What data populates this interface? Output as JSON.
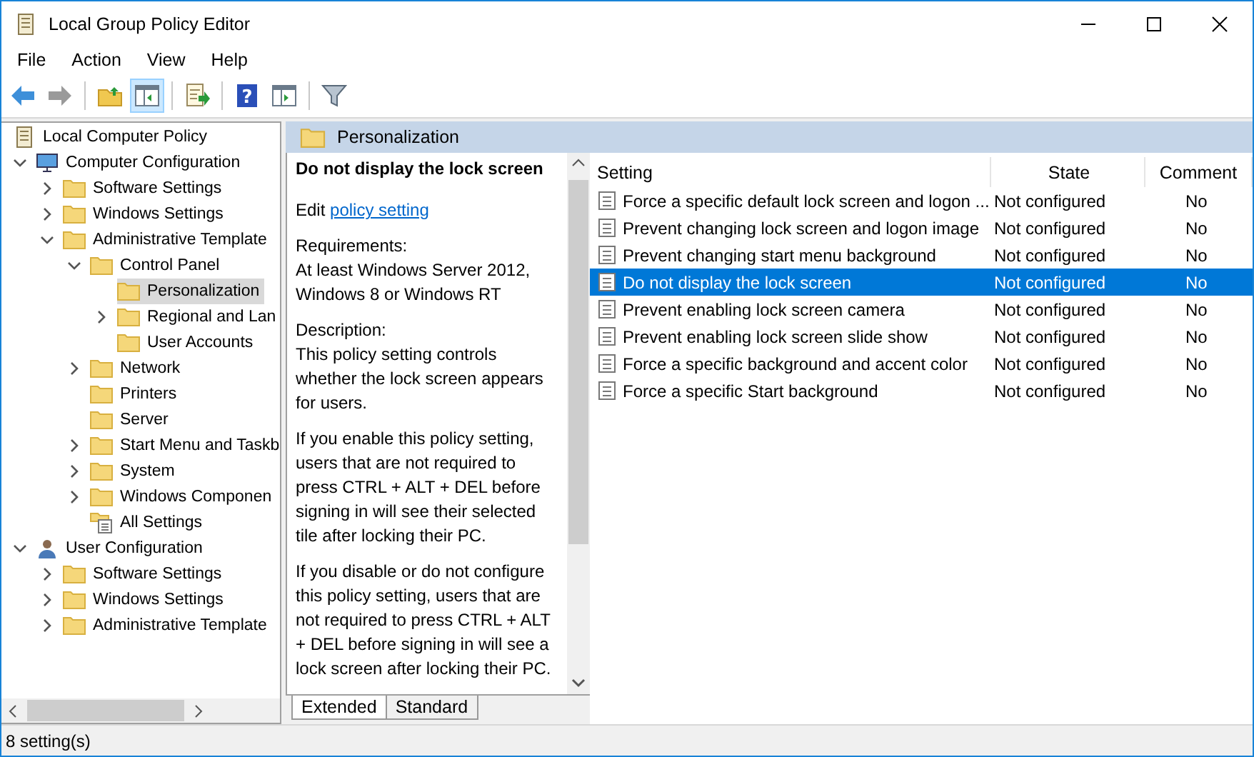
{
  "window": {
    "title": "Local Group Policy Editor"
  },
  "menu": [
    "File",
    "Action",
    "View",
    "Help"
  ],
  "toolbar": [
    {
      "kind": "back",
      "disabled": false,
      "pressed": false
    },
    {
      "kind": "forward",
      "disabled": true,
      "pressed": false
    },
    {
      "kind": "separator"
    },
    {
      "kind": "up",
      "pressed": false
    },
    {
      "kind": "tree-toggle",
      "pressed": true
    },
    {
      "kind": "separator"
    },
    {
      "kind": "export",
      "pressed": false
    },
    {
      "kind": "separator"
    },
    {
      "kind": "help",
      "glyph": "?",
      "pressed": false
    },
    {
      "kind": "pane-toggle",
      "pressed": false
    },
    {
      "kind": "separator"
    },
    {
      "kind": "filter",
      "pressed": false
    }
  ],
  "tree": {
    "label": "Local Computer Policy",
    "kind": "policy",
    "selected": false,
    "children": [
      {
        "label": "Computer Configuration",
        "kind": "computer",
        "expanded": true,
        "selected": false,
        "children": [
          {
            "label": "Software Settings",
            "kind": "folder",
            "expanded": false,
            "selected": false
          },
          {
            "label": "Windows Settings",
            "kind": "folder",
            "expanded": false,
            "selected": false
          },
          {
            "label": "Administrative Template",
            "kind": "folder",
            "expanded": true,
            "selected": false,
            "children": [
              {
                "label": "Control Panel",
                "kind": "folder",
                "expanded": true,
                "selected": false,
                "children": [
                  {
                    "label": "Personalization",
                    "kind": "folder",
                    "selected": true
                  },
                  {
                    "label": "Regional and Lan",
                    "kind": "folder",
                    "expanded": false,
                    "selected": false
                  },
                  {
                    "label": "User Accounts",
                    "kind": "folder",
                    "selected": false
                  }
                ]
              },
              {
                "label": "Network",
                "kind": "folder",
                "expanded": false,
                "selected": false
              },
              {
                "label": "Printers",
                "kind": "folder",
                "selected": false
              },
              {
                "label": "Server",
                "kind": "folder",
                "selected": false
              },
              {
                "label": "Start Menu and Taskb",
                "kind": "folder",
                "expanded": false,
                "selected": false
              },
              {
                "label": "System",
                "kind": "folder",
                "expanded": false,
                "selected": false
              },
              {
                "label": "Windows Componen",
                "kind": "folder",
                "expanded": false,
                "selected": false
              },
              {
                "label": "All Settings",
                "kind": "settings",
                "selected": false
              }
            ]
          }
        ]
      },
      {
        "label": "User Configuration",
        "kind": "user",
        "expanded": true,
        "selected": false,
        "children": [
          {
            "label": "Software Settings",
            "kind": "folder",
            "expanded": false,
            "selected": false
          },
          {
            "label": "Windows Settings",
            "kind": "folder",
            "expanded": false,
            "selected": false
          },
          {
            "label": "Administrative Template",
            "kind": "folder",
            "expanded": false,
            "selected": false
          }
        ]
      }
    ]
  },
  "header": {
    "title": "Personalization"
  },
  "description": {
    "title": "Do not display the lock screen",
    "edit_prefix": "Edit",
    "edit_link": "policy setting",
    "paragraphs": [
      "Requirements:\nAt least Windows Server 2012, Windows 8 or Windows RT",
      "Description:\nThis policy setting controls whether the lock screen appears for users.",
      "If you enable this policy setting, users that are not required to press CTRL + ALT + DEL before signing in will see their selected tile after locking their PC.",
      "If you disable or do not configure this policy setting, users that are not required to press CTRL + ALT + DEL before signing in will see a lock screen after locking their PC."
    ]
  },
  "view_tabs": [
    {
      "label": "Extended",
      "selected": true
    },
    {
      "label": "Standard",
      "selected": false
    }
  ],
  "table": {
    "columns": [
      "Setting",
      "State",
      "Comment"
    ],
    "rows": [
      {
        "setting": "Force a specific default lock screen and logon ...",
        "state": "Not configured",
        "comment": "No",
        "selected": false
      },
      {
        "setting": "Prevent changing lock screen and logon image",
        "state": "Not configured",
        "comment": "No",
        "selected": false
      },
      {
        "setting": "Prevent changing start menu background",
        "state": "Not configured",
        "comment": "No",
        "selected": false
      },
      {
        "setting": "Do not display the lock screen",
        "state": "Not configured",
        "comment": "No",
        "selected": true
      },
      {
        "setting": "Prevent enabling lock screen camera",
        "state": "Not configured",
        "comment": "No",
        "selected": false
      },
      {
        "setting": "Prevent enabling lock screen slide show",
        "state": "Not configured",
        "comment": "No",
        "selected": false
      },
      {
        "setting": "Force a specific background and accent color",
        "state": "Not configured",
        "comment": "No",
        "selected": false
      },
      {
        "setting": "Force a specific Start background",
        "state": "Not configured",
        "comment": "No",
        "selected": false
      }
    ]
  },
  "status_bar": {
    "text": "8 setting(s)"
  }
}
